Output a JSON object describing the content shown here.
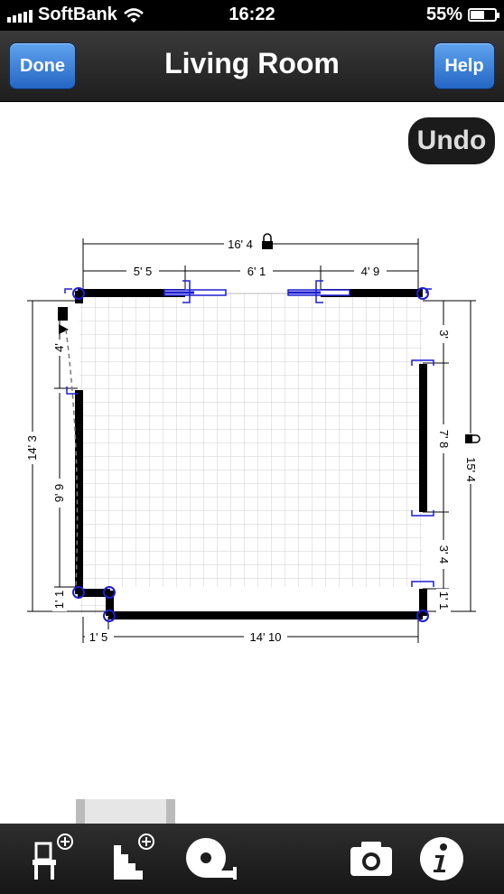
{
  "status_bar": {
    "carrier": "SoftBank",
    "time": "16:22",
    "battery": "55%"
  },
  "nav": {
    "done_label": "Done",
    "title": "Living Room",
    "help_label": "Help"
  },
  "undo_label": "Undo",
  "dimensions": {
    "top_total": "16' 4",
    "top_left": "5' 5",
    "top_mid": "6' 1",
    "top_right": "4' 9",
    "left_total": "14' 3",
    "left_door": "4'",
    "left_wall": "9' 9",
    "left_small": "1' 1",
    "bottom_left": "1' 5",
    "bottom_main": "14' 10",
    "right_total": "15' 4",
    "right_top": "3'",
    "right_mid": "7' 8",
    "right_lower": "3' 4",
    "right_bottom": "1' 1"
  },
  "toolbar_items": [
    "add-furniture-icon",
    "add-stairs-icon",
    "tape-measure-icon",
    "camera-icon",
    "info-icon"
  ],
  "colors": {
    "accent": "#2466c4",
    "wall": "#000000",
    "handle": "#1e1ed2"
  }
}
